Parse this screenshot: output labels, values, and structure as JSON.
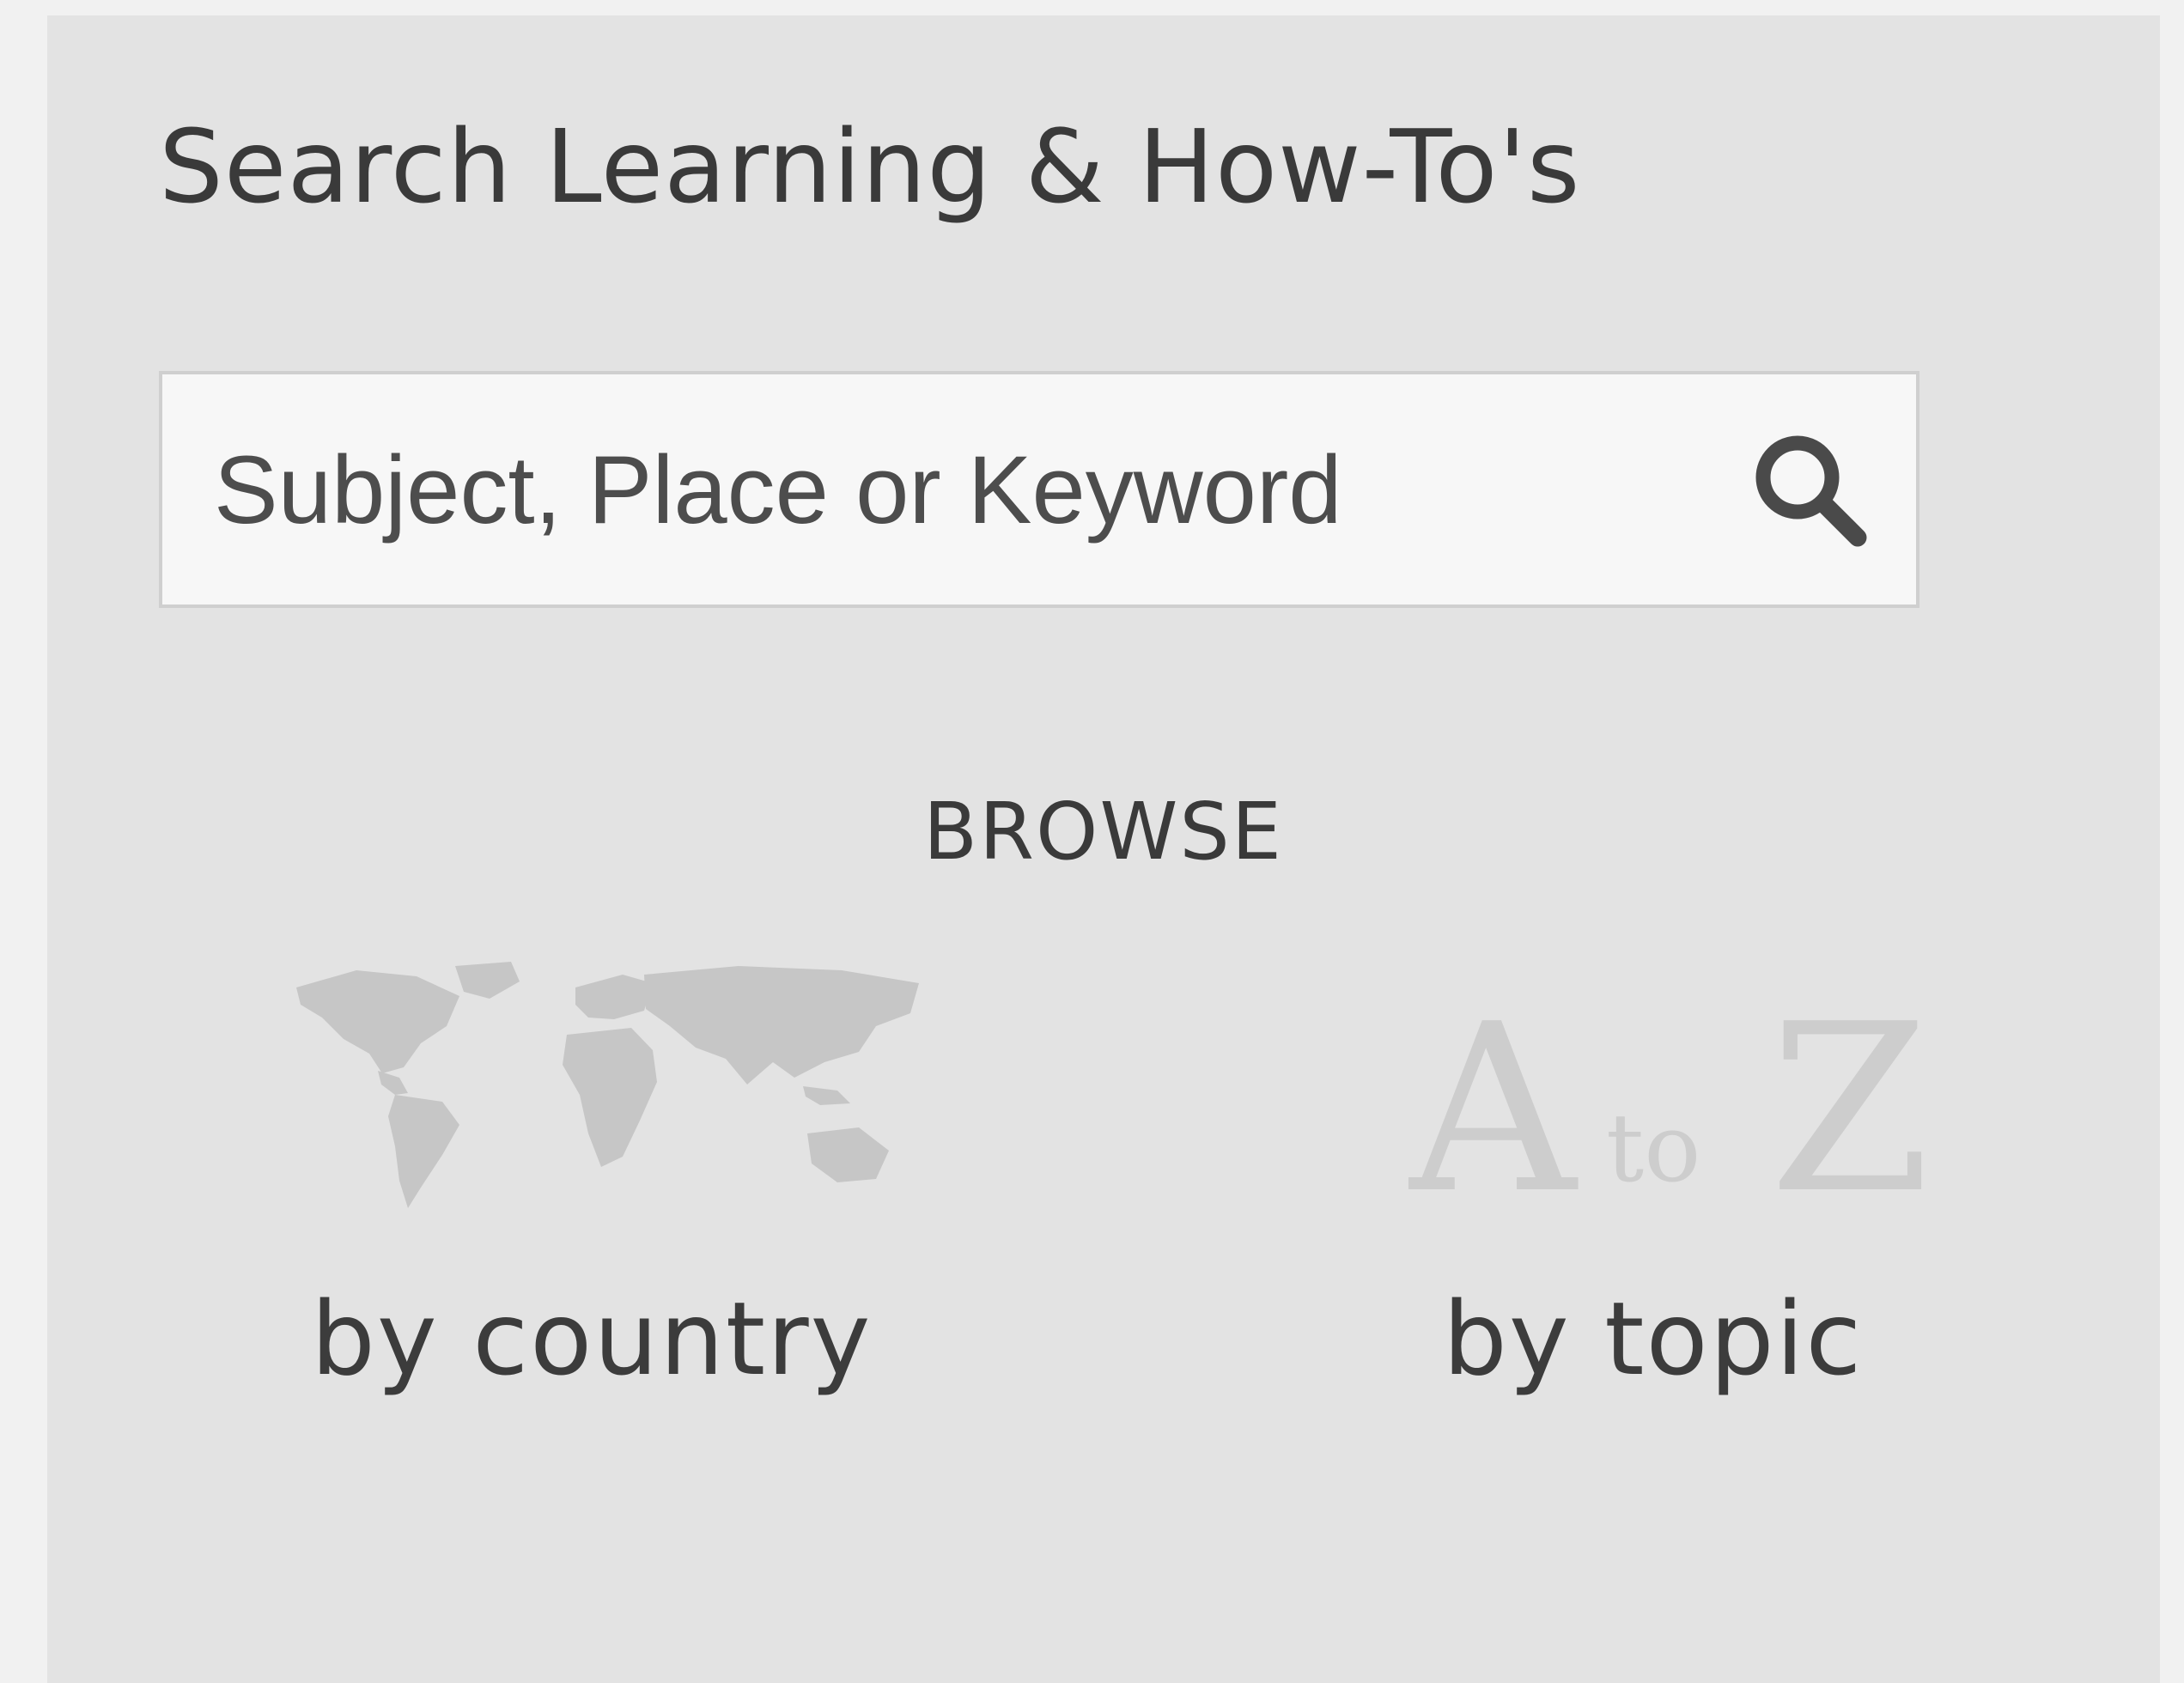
{
  "widget": {
    "title": "Search Learning & How-To's",
    "search": {
      "placeholder": "Subject, Place or Keyword",
      "value": "",
      "button_icon": "search-icon"
    },
    "browse": {
      "label": "BROWSE",
      "options": [
        {
          "label": "by country",
          "icon": "world-map-icon"
        },
        {
          "label": "by topic",
          "icon": "a-to-z-icon",
          "icon_text": "A to Z"
        }
      ]
    }
  },
  "colors": {
    "panel_background": "#e3e3e3",
    "search_background": "#f7f7f7",
    "text": "#3a3a3a",
    "icon_faded": "#c6c6c6"
  }
}
